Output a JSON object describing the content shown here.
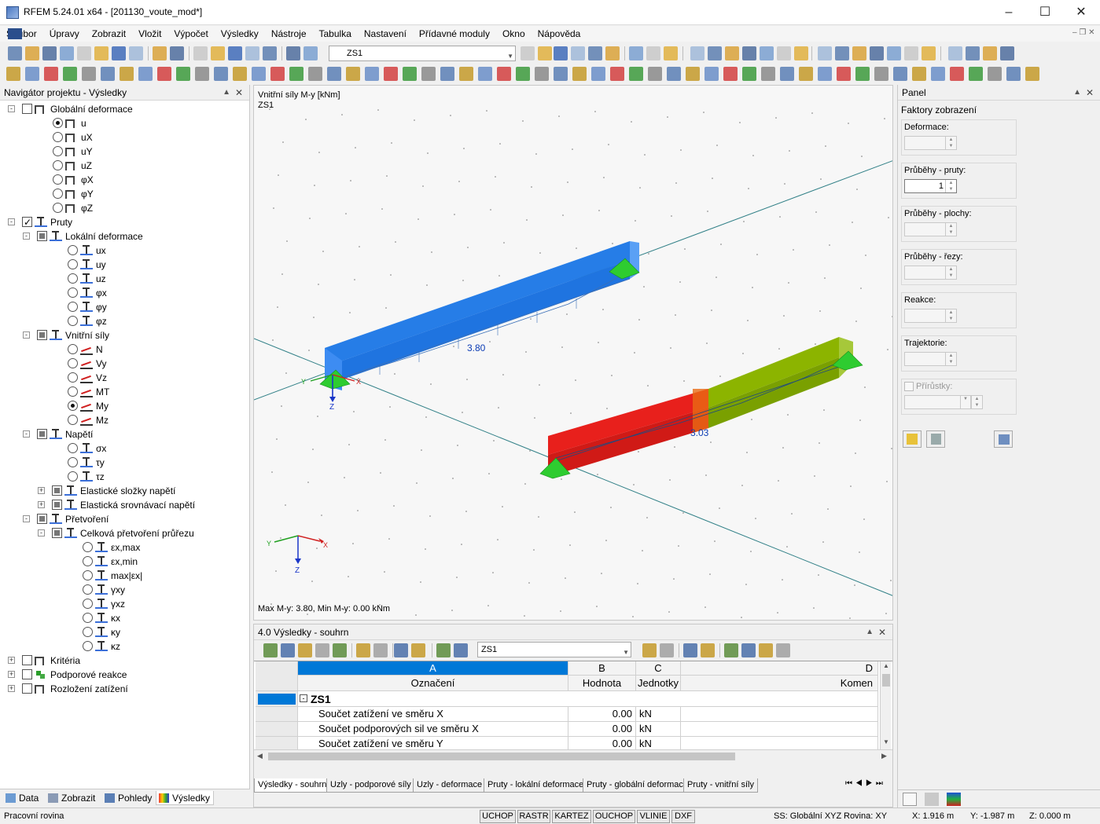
{
  "window": {
    "title": "RFEM 5.24.01 x64 - [201130_voute_mod*]"
  },
  "menu": [
    "Soubor",
    "Úpravy",
    "Zobrazit",
    "Vložit",
    "Výpočet",
    "Výsledky",
    "Nástroje",
    "Tabulka",
    "Nastavení",
    "Přídavné moduly",
    "Okno",
    "Nápověda"
  ],
  "toolbar": {
    "loadcase": "ZS1"
  },
  "navigator": {
    "title": "Navigátor projektu - Výsledky",
    "items": {
      "global_def": "Globální deformace",
      "u": "u",
      "ux": "uX",
      "uy": "uY",
      "uz": "uZ",
      "phix": "φX",
      "phiy": "φY",
      "phiz": "φZ",
      "members": "Pruty",
      "local_def": "Lokální deformace",
      "lux": "ux",
      "luy": "uy",
      "luz": "uz",
      "lphix": "φx",
      "lphiy": "φy",
      "lphiz": "φz",
      "internal": "Vnitřní síly",
      "N": "N",
      "Vy": "Vy",
      "Vz": "Vz",
      "MT": "MT",
      "My": "My",
      "Mz": "Mz",
      "stress": "Napětí",
      "sx": "σx",
      "ty": "τy",
      "tz": "τz",
      "elastic_comp": "Elastické složky napětí",
      "elastic_eq": "Elastická srovnávací napětí",
      "strain": "Přetvoření",
      "total_strain": "Celková přetvoření průřezu",
      "exmax": "εx,max",
      "exmin": "εx,min",
      "maxex": "max|εx|",
      "gxy": "γxy",
      "gxz": "γxz",
      "kx": "κx",
      "ky": "κy",
      "kz": "κz",
      "criteria": "Kritéria",
      "support": "Podporové reakce",
      "load_dist": "Rozložení zatížení"
    },
    "tabs": [
      "Data",
      "Zobrazit",
      "Pohledy",
      "Výsledky"
    ]
  },
  "viewport": {
    "header1": "Vnitřní síly M-y [kNm]",
    "header2": "ZS1",
    "val1": "3.80",
    "val2": "3.03",
    "footer": "Max M-y: 3.80, Min M-y: 0.00 kNm",
    "axes": {
      "x": "X",
      "y": "Y",
      "z": "Z"
    }
  },
  "panel": {
    "title": "Panel",
    "section": "Faktory zobrazení",
    "groups": [
      {
        "label": "Deformace:",
        "value": ""
      },
      {
        "label": "Průběhy - pruty:",
        "value": "1"
      },
      {
        "label": "Průběhy - plochy:",
        "value": ""
      },
      {
        "label": "Průběhy - řezy:",
        "value": ""
      },
      {
        "label": "Reakce:",
        "value": ""
      },
      {
        "label": "Trajektorie:",
        "value": ""
      },
      {
        "label": "Přírůstky:",
        "value": ""
      }
    ]
  },
  "results": {
    "title": "4.0 Výsledky - souhrn",
    "loadcase": "ZS1",
    "cols": [
      "A",
      "B",
      "C",
      "D"
    ],
    "headers": [
      "Označení",
      "Hodnota",
      "Jednotky",
      "Komen"
    ],
    "group": "ZS1",
    "rows": [
      {
        "label": "Součet zatížení ve směru X",
        "value": "0.00",
        "unit": "kN"
      },
      {
        "label": "Součet podporových sil ve směru X",
        "value": "0.00",
        "unit": "kN"
      },
      {
        "label": "Součet zatížení ve směru Y",
        "value": "0.00",
        "unit": "kN"
      }
    ],
    "tabs": [
      "Výsledky - souhrn",
      "Uzly - podporové síly",
      "Uzly - deformace",
      "Pruty - lokální deformace",
      "Pruty - globální deformace",
      "Pruty - vnitřní síly"
    ]
  },
  "status": {
    "left": "Pracovní rovina",
    "buttons": [
      "UCHOP",
      "RASTR",
      "KARTEZ",
      "OUCHOP",
      "VLINIE",
      "DXF"
    ],
    "ss": "SS: Globální XYZ",
    "plane": "Rovina: XY",
    "x": "X:  1.916 m",
    "y": "Y:  -1.987 m",
    "z": "Z:  0.000 m"
  },
  "colors": {
    "accent": "#0078d7",
    "beam_blue": "#1e78e6",
    "beam_red": "#e8201c",
    "beam_green": "#8cb400",
    "support": "#22c02a"
  }
}
